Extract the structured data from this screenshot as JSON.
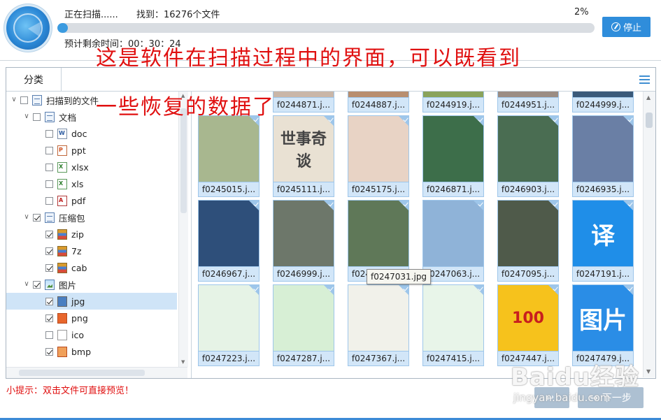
{
  "header": {
    "status": "正在扫描......",
    "found": "找到：16276个文件",
    "percent": "2%",
    "progress": 0.02,
    "remaining": "预计剩余时间：00：30：24",
    "stop_label": "停止"
  },
  "annotation": {
    "line1": "这是软件在扫描过程中的界面，可以既看到",
    "line2": "一些恢复的数据了"
  },
  "tab": "分类",
  "tree": [
    {
      "label": "扫描到的文件",
      "level": 0,
      "toggle": "∨",
      "checked": false,
      "icon": "doc"
    },
    {
      "label": "文档",
      "level": 1,
      "toggle": "∨",
      "checked": false,
      "icon": "doc"
    },
    {
      "label": "doc",
      "level": 2,
      "checked": false,
      "icon": "word"
    },
    {
      "label": "ppt",
      "level": 2,
      "checked": false,
      "icon": "ppt"
    },
    {
      "label": "xlsx",
      "level": 2,
      "checked": false,
      "icon": "xls"
    },
    {
      "label": "xls",
      "level": 2,
      "checked": false,
      "icon": "xls"
    },
    {
      "label": "pdf",
      "level": 2,
      "checked": false,
      "icon": "pdf"
    },
    {
      "label": "压缩包",
      "level": 1,
      "toggle": "∨",
      "checked": true,
      "icon": "doc"
    },
    {
      "label": "zip",
      "level": 2,
      "checked": true,
      "icon": "zip"
    },
    {
      "label": "7z",
      "level": 2,
      "checked": true,
      "icon": "zip"
    },
    {
      "label": "cab",
      "level": 2,
      "checked": true,
      "icon": "zip"
    },
    {
      "label": "图片",
      "level": 1,
      "toggle": "∨",
      "checked": true,
      "icon": "img"
    },
    {
      "label": "jpg",
      "level": 2,
      "checked": true,
      "icon": "jpg",
      "selected": true
    },
    {
      "label": "png",
      "level": 2,
      "checked": true,
      "icon": "png"
    },
    {
      "label": "ico",
      "level": 2,
      "checked": false,
      "icon": "ico"
    },
    {
      "label": "bmp",
      "level": 2,
      "checked": true,
      "icon": "bmp"
    }
  ],
  "files": [
    {
      "name": "f0244871.j...",
      "bg": "#c9b6a8"
    },
    {
      "name": "f0244887.j...",
      "bg": "#b88e6f"
    },
    {
      "name": "f0244919.j...",
      "bg": "#8aa35b"
    },
    {
      "name": "f0244951.j...",
      "bg": "#9b8d84"
    },
    {
      "name": "f0244999.j...",
      "bg": "#3b5a7a"
    },
    {
      "name": "f0245015.j...",
      "bg": "#a8b78f"
    },
    {
      "name": "f0245111.j...",
      "bg": "#e9e1d3",
      "text": "世事奇谈"
    },
    {
      "name": "f0245175.j...",
      "bg": "#e8d3c5"
    },
    {
      "name": "f0246871.j...",
      "bg": "#3d6e4a"
    },
    {
      "name": "f0246903.j...",
      "bg": "#4a6d52"
    },
    {
      "name": "f0246935.j...",
      "bg": "#6a7fa5"
    },
    {
      "name": "f0246967.j...",
      "bg": "#2e4f7a"
    },
    {
      "name": "f0246999.j...",
      "bg": "#6d776a"
    },
    {
      "name": "f0247031.j...",
      "bg": "#5f7858"
    },
    {
      "name": "f0247063.j...",
      "bg": "#8fb3d8"
    },
    {
      "name": "f0247095.j...",
      "bg": "#4f5a4a"
    },
    {
      "name": "f0247191.j...",
      "bg": "#1f8ee8",
      "text": "译"
    },
    {
      "name": "f0247223.j...",
      "bg": "#e6f3e6"
    },
    {
      "name": "f0247287.j...",
      "bg": "#d7efd5"
    },
    {
      "name": "f0247367.j...",
      "bg": "#f1f1ea"
    },
    {
      "name": "f0247415.j...",
      "bg": "#e8f5e9"
    },
    {
      "name": "f0247447.j...",
      "bg": "#f6c21c",
      "text": "100"
    },
    {
      "name": "f0247479.j...",
      "bg": "#2a8de6",
      "text": "图片"
    }
  ],
  "tooltip": "f0247031.jpg",
  "tip": "小提示：双击文件可直接预览！",
  "footer": {
    "back_label": "",
    "next_label": "下一步",
    "watermark": "Baidu经验",
    "watermark_url": "jingyan.baidu.com"
  },
  "colors": {
    "accent": "#2f8ddb",
    "annotation": "#e01010",
    "progress": "#3b9be0"
  }
}
